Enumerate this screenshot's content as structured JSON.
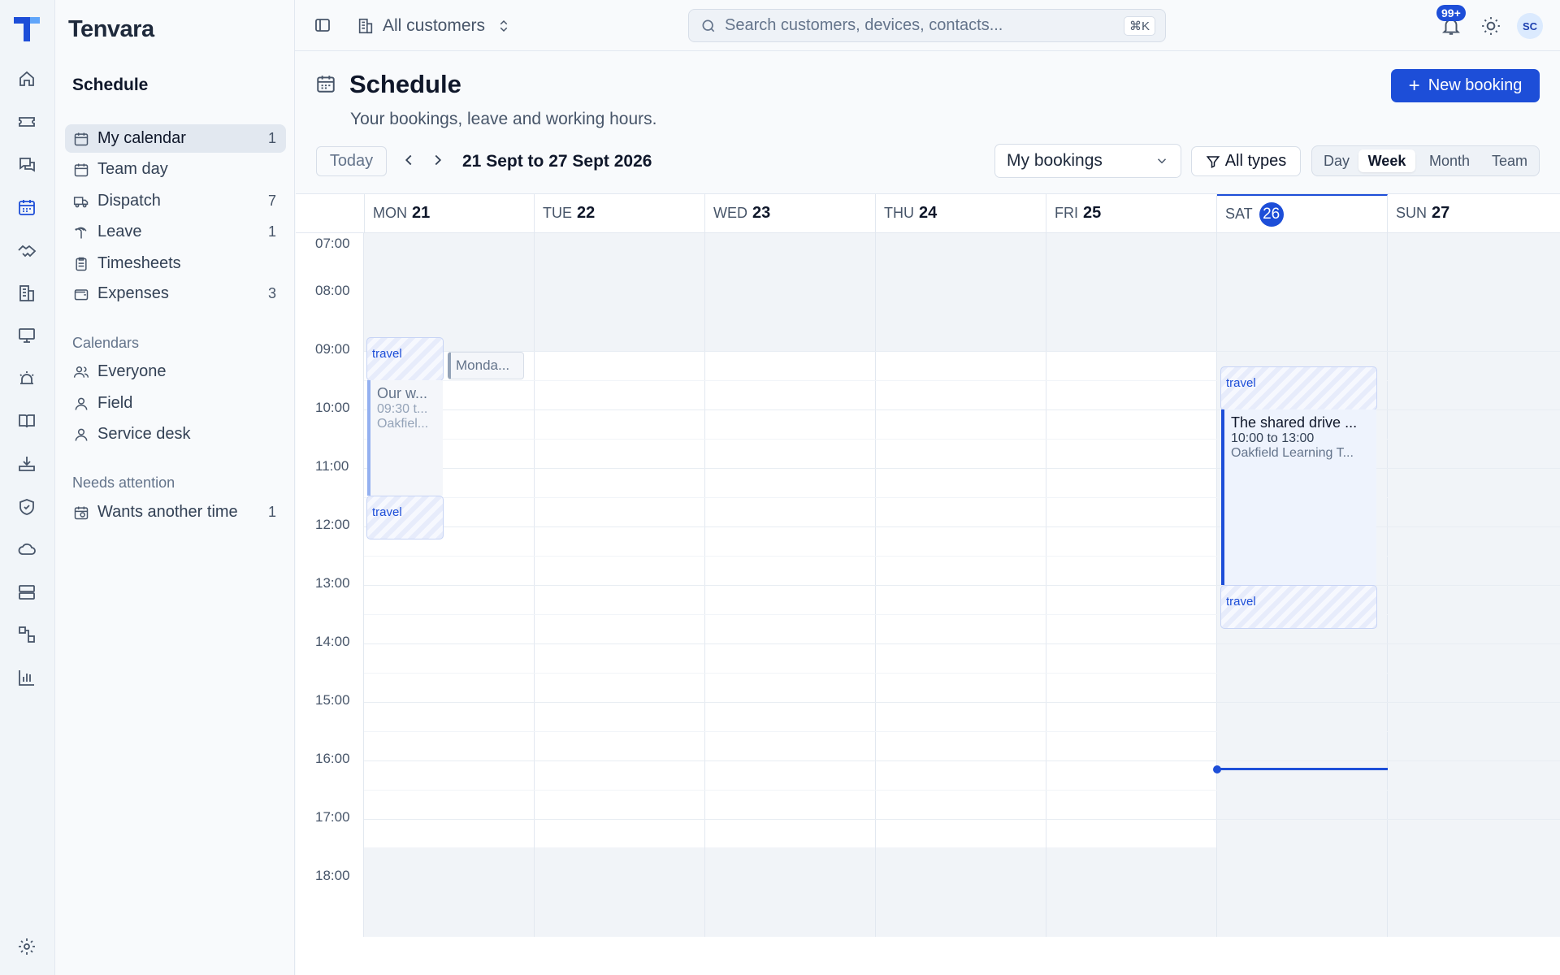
{
  "app": {
    "name": "Tenvara"
  },
  "rail": {
    "icons": [
      "home-icon",
      "ticket-icon",
      "chat-icon",
      "calendar-icon",
      "handshake-icon",
      "building-icon",
      "monitor-icon",
      "alert-icon",
      "book-icon",
      "download-tray-icon",
      "shield-icon",
      "cloud-icon",
      "server-icon",
      "workflow-icon",
      "chart-icon",
      "settings-icon"
    ]
  },
  "sidebar": {
    "title": "Schedule",
    "items": [
      {
        "label": "My calendar",
        "count": "1",
        "icon": "calendar-icon"
      },
      {
        "label": "Team day",
        "count": "",
        "icon": "calendar-icon"
      },
      {
        "label": "Dispatch",
        "count": "7",
        "icon": "truck-icon"
      },
      {
        "label": "Leave",
        "count": "1",
        "icon": "palm-icon"
      },
      {
        "label": "Timesheets",
        "count": "",
        "icon": "clipboard-icon"
      },
      {
        "label": "Expenses",
        "count": "3",
        "icon": "wallet-icon"
      }
    ],
    "calendars_label": "Calendars",
    "calendars": [
      {
        "label": "Everyone",
        "icon": "users-icon"
      },
      {
        "label": "Field",
        "icon": "user-icon"
      },
      {
        "label": "Service desk",
        "icon": "user-icon"
      }
    ],
    "attention_label": "Needs attention",
    "attention": [
      {
        "label": "Wants another time",
        "count": "1",
        "icon": "calendar-clock-icon"
      }
    ]
  },
  "topbar": {
    "customer_scope": "All customers",
    "search_placeholder": "Search customers, devices, contacts...",
    "shortcut": "⌘K",
    "notifications": "99+",
    "avatar": "SC"
  },
  "page": {
    "title": "Schedule",
    "subtitle": "Your bookings, leave and working hours.",
    "new_button": "New booking"
  },
  "toolbar": {
    "today": "Today",
    "range": "21 Sept to 27 Sept 2026",
    "filter_select": "My bookings",
    "types": "All types",
    "views": [
      "Day",
      "Week",
      "Month",
      "Team"
    ],
    "active_view": "Week"
  },
  "calendar": {
    "days": [
      {
        "dow": "MON",
        "num": "21"
      },
      {
        "dow": "TUE",
        "num": "22"
      },
      {
        "dow": "WED",
        "num": "23"
      },
      {
        "dow": "THU",
        "num": "24"
      },
      {
        "dow": "FRI",
        "num": "25"
      },
      {
        "dow": "SAT",
        "num": "26",
        "today": true
      },
      {
        "dow": "SUN",
        "num": "27"
      }
    ],
    "hours": [
      "07:00",
      "08:00",
      "09:00",
      "10:00",
      "11:00",
      "12:00",
      "13:00",
      "14:00",
      "15:00",
      "16:00",
      "17:00",
      "18:00"
    ],
    "working_hours": {
      "start": "09:00",
      "end": "18:00"
    },
    "now": "16:10",
    "events": {
      "mon_travel_before": "travel",
      "mon_event_title": "Our w...",
      "mon_event_time": "09:30 t...",
      "mon_event_location": "Oakfiel...",
      "mon_travel_after": "travel",
      "mon_chip": "Monda...",
      "sat_travel_before": "travel",
      "sat_event_title": "The shared drive ...",
      "sat_event_time": "10:00 to 13:00",
      "sat_event_location": "Oakfield Learning T...",
      "sat_travel_after": "travel"
    }
  },
  "colors": {
    "accent": "#1d4ed8",
    "offhours": "#f1f4f8"
  }
}
